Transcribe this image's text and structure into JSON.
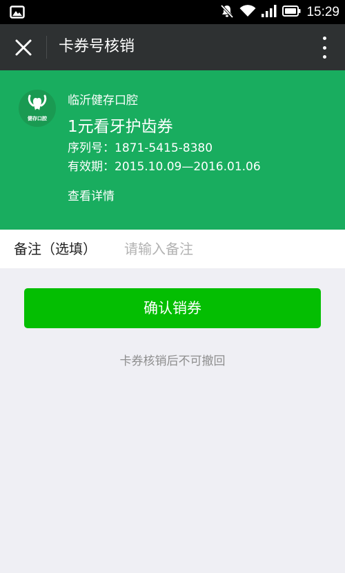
{
  "status_bar": {
    "time": "15:29",
    "icons": [
      "image-notification-icon",
      "mute-icon",
      "wifi-icon",
      "signal-icon",
      "battery-icon"
    ]
  },
  "nav": {
    "title": "卡券号核销",
    "close_icon": "close-icon",
    "more_icon": "more-vertical-icon"
  },
  "coupon": {
    "logo_text": "健存口腔",
    "merchant": "临沂健存口腔",
    "title": "1元看牙护齿券",
    "serial": "序列号：1871-5415-8380",
    "validity": "有效期：2015.10.09—2016.01.06",
    "detail_link": "查看详情",
    "color": "#19ad5f"
  },
  "remark": {
    "label": "备注（选填）",
    "placeholder": "请输入备注",
    "value": ""
  },
  "confirm": {
    "label": "确认销券",
    "color": "#04be02"
  },
  "notice": "卡券核销后不可撤回"
}
